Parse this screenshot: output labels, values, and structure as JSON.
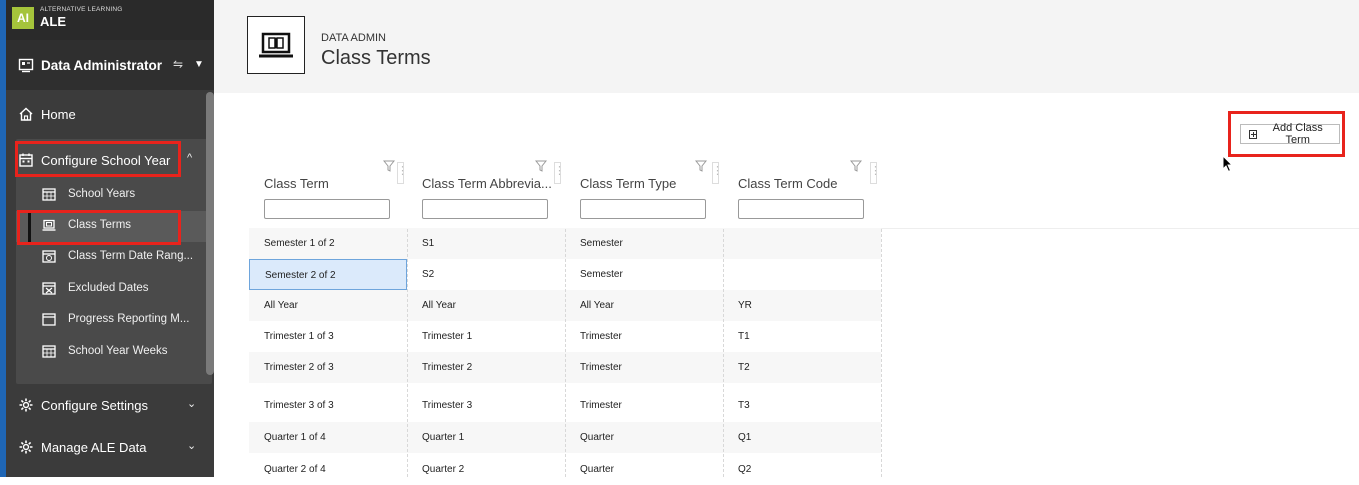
{
  "brand": {
    "logo_text": "AI",
    "small": "ALTERNATIVE LEARNING",
    "big": "ALE"
  },
  "role": {
    "label": "Data Administrator"
  },
  "nav": {
    "home": "Home",
    "configure_school_year": "Configure School Year",
    "sub_items": [
      "School Years",
      "Class Terms",
      "Class Term Date Rang...",
      "Excluded Dates",
      "Progress Reporting M...",
      "School Year Weeks"
    ],
    "configure_settings": "Configure Settings",
    "manage_ale_data": "Manage ALE Data"
  },
  "header": {
    "breadcrumb": "DATA ADMIN",
    "title": "Class Terms"
  },
  "toolbar": {
    "add_label": "Add Class Term"
  },
  "grid": {
    "columns": [
      "Class Term",
      "Class Term Abbrevia...",
      "Class Term Type",
      "Class Term Code"
    ],
    "rows": [
      [
        "Semester 1 of 2",
        "S1",
        "Semester",
        ""
      ],
      [
        "Semester 2 of 2",
        "S2",
        "Semester",
        ""
      ],
      [
        "All Year",
        "All Year",
        "All Year",
        "YR"
      ],
      [
        "Trimester 1 of 3",
        "Trimester 1",
        "Trimester",
        "T1"
      ],
      [
        "Trimester 2 of 3",
        "Trimester 2",
        "Trimester",
        "T2"
      ],
      [
        "Trimester 3 of 3",
        "Trimester 3",
        "Trimester",
        "T3"
      ],
      [
        "Quarter 1 of 4",
        "Quarter 1",
        "Quarter",
        "Q1"
      ],
      [
        "Quarter 2 of 4",
        "Quarter 2",
        "Quarter",
        "Q2"
      ]
    ]
  },
  "colors": {
    "accent_red": "#e8231c",
    "sidebar": "#3b3b3b",
    "logo_green": "#a5c43b",
    "selected_cell": "#dbeafb"
  }
}
